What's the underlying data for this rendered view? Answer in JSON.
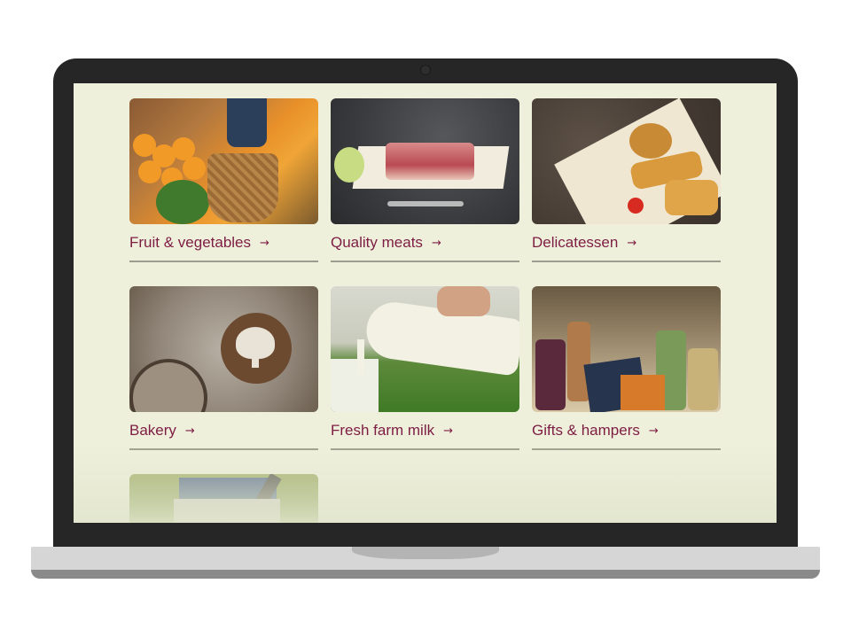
{
  "categories": [
    {
      "label": "Fruit & vegetables",
      "arrow": "→",
      "image": "fruit-vegetables-photo"
    },
    {
      "label": "Quality meats",
      "arrow": "→",
      "image": "quality-meats-photo"
    },
    {
      "label": "Delicatessen",
      "arrow": "→",
      "image": "delicatessen-photo"
    },
    {
      "label": "Bakery",
      "arrow": "→",
      "image": "bakery-photo"
    },
    {
      "label": "Fresh farm milk",
      "arrow": "→",
      "image": "fresh-farm-milk-photo"
    },
    {
      "label": "Gifts & hampers",
      "arrow": "→",
      "image": "gifts-hampers-photo"
    },
    {
      "label": "",
      "arrow": "",
      "image": "hamper-bag-photo"
    }
  ],
  "colors": {
    "page_background": "#eff0dc",
    "label_text": "#7d1d43",
    "divider": "#9c9d8e",
    "laptop_bezel": "#262626",
    "laptop_base": "#d6d6d6"
  }
}
